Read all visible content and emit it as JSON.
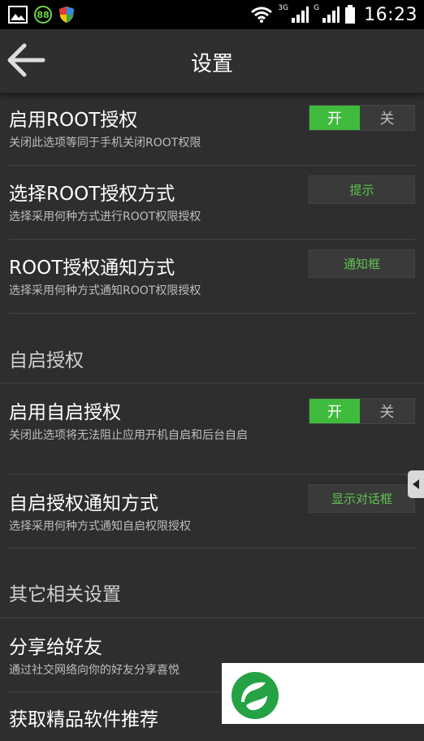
{
  "status_bar": {
    "badge": "88",
    "net_3g": "3G",
    "net_g": "G",
    "time": "16:23"
  },
  "header": {
    "title": "设置"
  },
  "root_section": {
    "enable_root": {
      "title": "启用ROOT授权",
      "subtitle": "关闭此选项等同于手机关闭ROOT权限",
      "on_label": "开",
      "off_label": "关"
    },
    "choose_method": {
      "title": "选择ROOT授权方式",
      "subtitle": "选择采用何种方式进行ROOT权限授权",
      "value": "提示"
    },
    "notify_method": {
      "title": "ROOT授权通知方式",
      "subtitle": "选择采用何种方式通知ROOT权限授权",
      "value": "通知框"
    }
  },
  "autostart_section": {
    "header": "自启授权",
    "enable_autostart": {
      "title": "启用自启授权",
      "subtitle": "关闭此选项将无法阻止应用开机自启和后台自启",
      "on_label": "开",
      "off_label": "关"
    },
    "notify_method": {
      "title": "自启授权通知方式",
      "subtitle": "选择采用何种方式通知自启权限授权",
      "value": "显示对话框"
    }
  },
  "other_section": {
    "header": "其它相关设置",
    "share": {
      "title": "分享给好友",
      "subtitle": "通过社交网络向你的好友分享喜悦"
    },
    "recommend": {
      "title": "获取精品软件推荐"
    }
  },
  "colors": {
    "accent_green": "#3fbb3d",
    "value_green": "#5ec24f",
    "background": "#2e2e2e"
  }
}
